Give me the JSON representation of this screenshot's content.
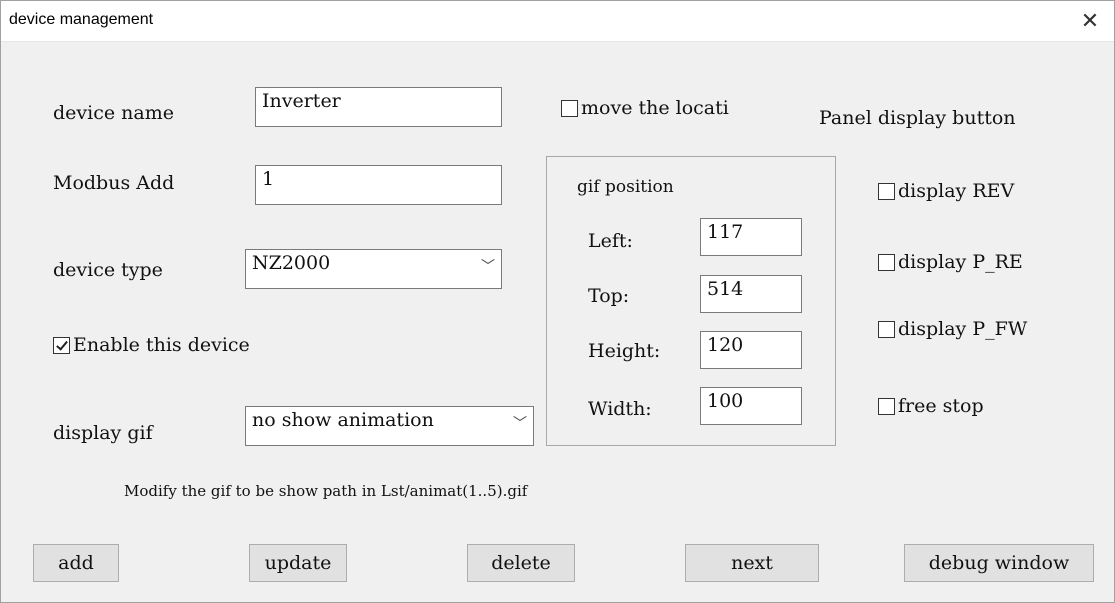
{
  "window": {
    "title": "device management",
    "close_glyph": "✕"
  },
  "form": {
    "device_name_label": "device name",
    "device_name_value": "Inverter",
    "modbus_label": "Modbus Add",
    "modbus_value": "1",
    "device_type_label": "device type",
    "device_type_value": "NZ2000",
    "enable_label": "Enable this device",
    "enable_checked": true,
    "display_gif_label": "display gif",
    "display_gif_value": "no show animation",
    "move_location_label": "move the locati",
    "move_location_checked": false
  },
  "gif_position": {
    "title": "gif position",
    "left_label": "Left:",
    "left_value": "117",
    "top_label": "Top:",
    "top_value": "514",
    "height_label": "Height:",
    "height_value": "120",
    "width_label": "Width:",
    "width_value": "100"
  },
  "panel": {
    "title": "Panel display button",
    "options": [
      {
        "label": "display REV",
        "checked": false
      },
      {
        "label": "display P_RE",
        "checked": false
      },
      {
        "label": "display P_FW",
        "checked": false
      },
      {
        "label": "free stop",
        "checked": false
      }
    ]
  },
  "note": "Modify the gif to be show path in  Lst/animat(1..5).gif",
  "buttons": {
    "add": "add",
    "update": "update",
    "delete": "delete",
    "next": "next",
    "debug": "debug window"
  }
}
